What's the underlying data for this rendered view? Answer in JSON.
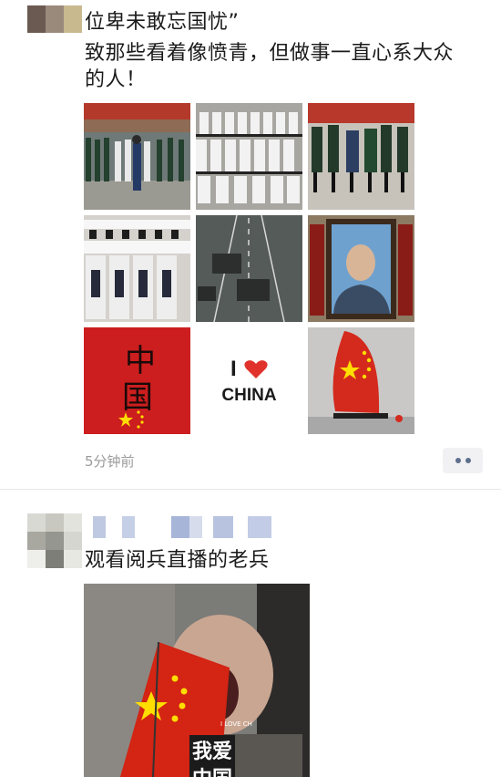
{
  "post1": {
    "text_line1": "位卑未敢忘国忧”",
    "text_line2": "致那些看着像愤青，但做事一直心系大众",
    "text_line3": "的人！",
    "tile_red_text": "中国",
    "tile_love_i": "I",
    "tile_love_china": "CHINA",
    "time": "5分钟前"
  },
  "post2": {
    "text": "观看阅兵直播的老兵",
    "photo_caption_line1": "我爱",
    "photo_caption_line2": "中国",
    "photo_small_text": "I LOVE CH"
  },
  "colors": {
    "flag_red": "#de2910",
    "flag_yellow": "#ffde00",
    "heart_red": "#e0322b"
  },
  "icons": {
    "more": "more-dots-icon"
  }
}
